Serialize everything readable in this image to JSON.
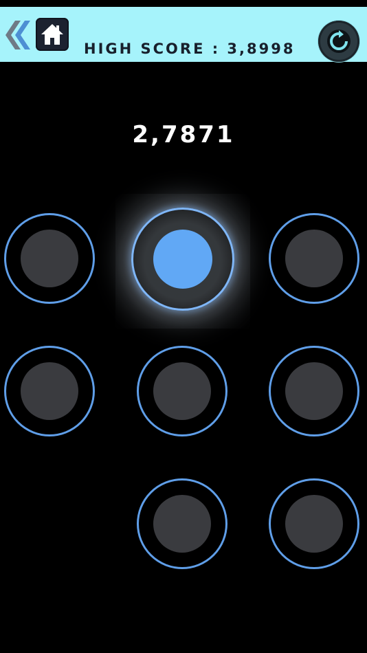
{
  "header": {
    "high_score_label": "HIGH SCORE : 3,8998",
    "back_icon": "double-chevron-left-icon",
    "home_icon": "home-icon",
    "refresh_icon": "refresh-icon"
  },
  "game": {
    "current_score": "2,7871",
    "active_pad": 2,
    "pads_present": [
      1,
      2,
      3,
      4,
      5,
      6,
      8,
      9
    ]
  },
  "colors": {
    "top_bar": "#a6f3fb",
    "ring": "#5f9ee8",
    "active_core": "#61a8f5",
    "idle_core": "#3a3b3f",
    "background": "#000000"
  }
}
